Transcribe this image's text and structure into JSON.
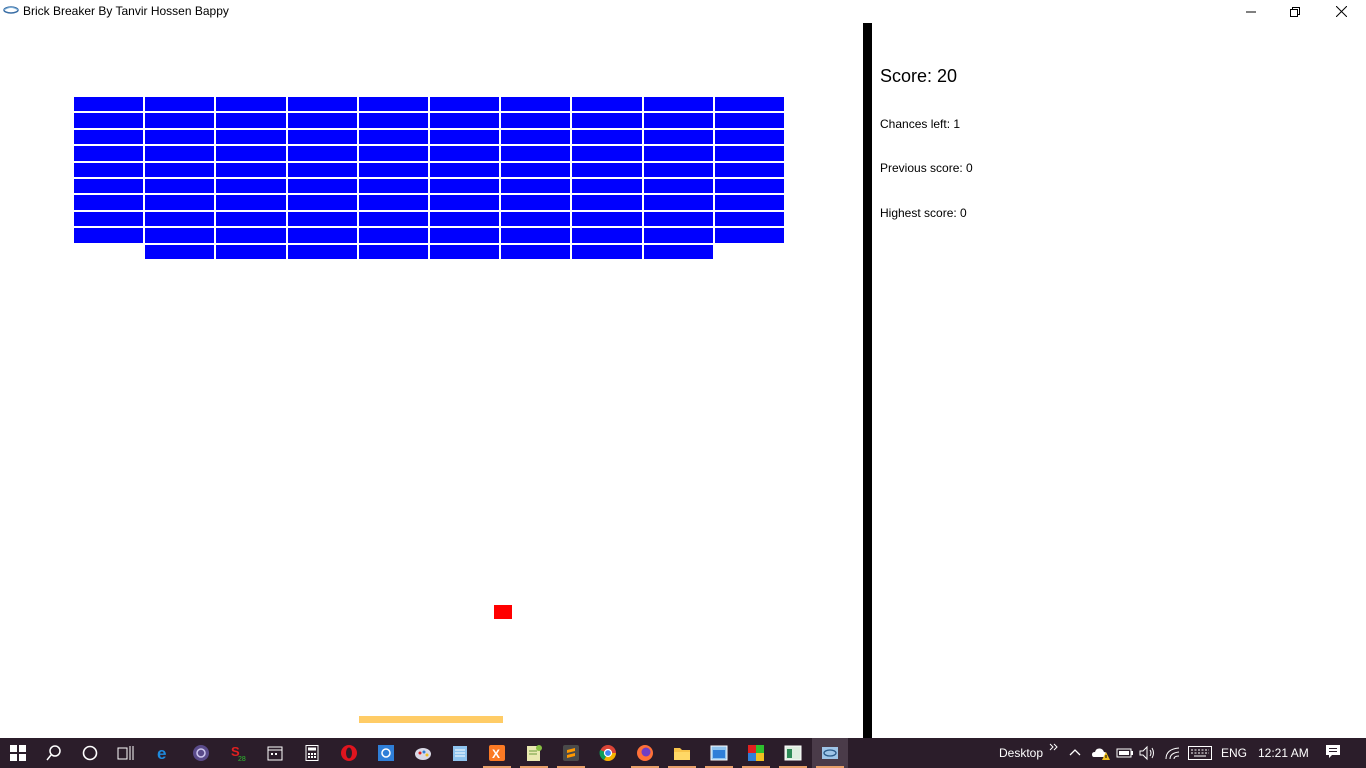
{
  "window": {
    "title": "Brick Breaker By Tanvir Hossen Bappy",
    "controls": [
      "minimize-icon",
      "restore-icon",
      "close-icon"
    ]
  },
  "game": {
    "brick_color": "#0000ff",
    "ball_color": "#ff0000",
    "paddle_color": "#ffcc66",
    "brick_rows": [
      [
        1,
        1,
        1,
        1,
        1,
        1,
        1,
        1,
        1,
        1
      ],
      [
        1,
        1,
        1,
        1,
        1,
        1,
        1,
        1,
        1,
        1
      ],
      [
        1,
        1,
        1,
        1,
        1,
        1,
        1,
        1,
        1,
        1
      ],
      [
        1,
        1,
        1,
        1,
        1,
        1,
        1,
        1,
        1,
        1
      ],
      [
        1,
        1,
        1,
        1,
        1,
        1,
        1,
        1,
        1,
        1
      ],
      [
        1,
        1,
        1,
        1,
        1,
        1,
        1,
        1,
        1,
        1
      ],
      [
        1,
        1,
        1,
        1,
        1,
        1,
        1,
        1,
        1,
        1
      ],
      [
        1,
        1,
        1,
        1,
        1,
        1,
        1,
        1,
        1,
        1
      ],
      [
        1,
        1,
        1,
        1,
        1,
        1,
        1,
        1,
        1,
        1
      ],
      [
        0,
        1,
        1,
        1,
        1,
        1,
        1,
        1,
        1,
        0
      ]
    ]
  },
  "panel": {
    "score": "Score: 20",
    "chances": "Chances left: 1",
    "previous": "Previous score: 0",
    "highest": "Highest score: 0"
  },
  "taskbar": {
    "apps": [
      "windows-start-icon",
      "search-icon",
      "cortana-icon",
      "task-view-icon",
      "edge-icon",
      "media-player-icon",
      "app-s-icon",
      "calendar-icon",
      "calculator-icon",
      "opera-icon",
      "app-blue-icon",
      "paint-icon",
      "notepad-icon",
      "xampp-icon",
      "notepad-plus-icon",
      "sublime-icon",
      "chrome-icon",
      "firefox-icon",
      "file-explorer-icon",
      "app-window-icon",
      "app-color-icon",
      "app-green-icon",
      "brick-breaker-icon"
    ],
    "desktop_label": "Desktop",
    "language": "ENG",
    "time": "12:21 AM"
  }
}
